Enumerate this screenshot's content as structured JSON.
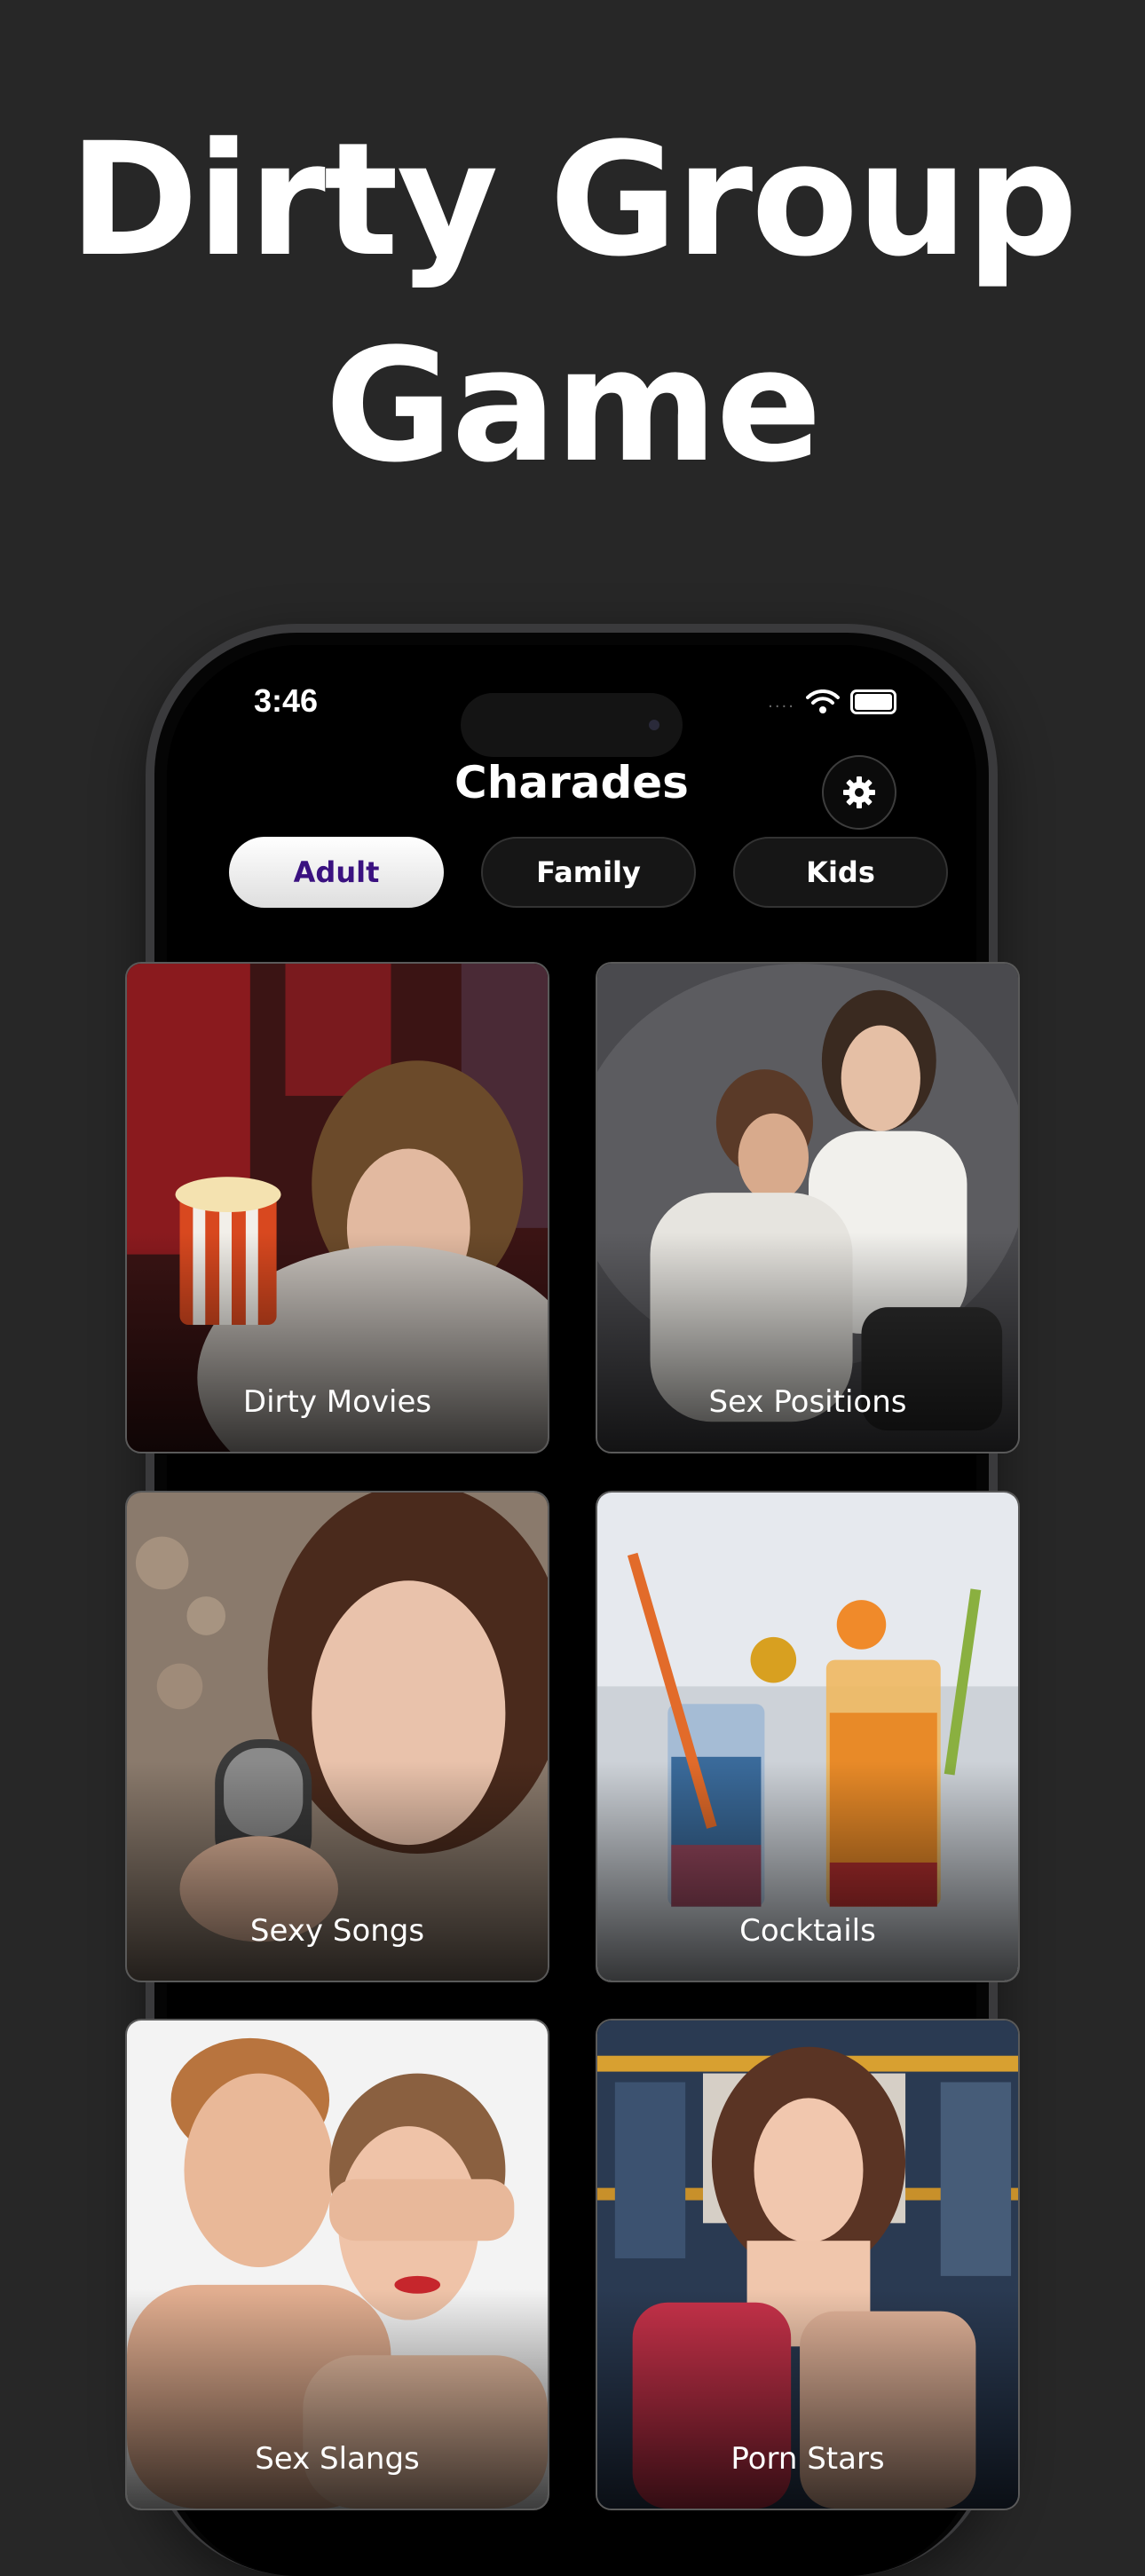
{
  "headline": {
    "line1": "Dirty Group",
    "line2": "Game"
  },
  "status_bar": {
    "time": "3:46",
    "signal": "....",
    "wifi_icon": "wifi-icon",
    "battery_icon": "battery-icon"
  },
  "app": {
    "title": "Charades",
    "settings_icon": "gear-icon"
  },
  "tabs": [
    {
      "label": "Adult",
      "active": true
    },
    {
      "label": "Family",
      "active": false
    },
    {
      "label": "Kids",
      "active": false
    }
  ],
  "categories": [
    {
      "label": "Dirty Movies"
    },
    {
      "label": "Sex Positions"
    },
    {
      "label": "Sexy Songs"
    },
    {
      "label": "Cocktails"
    },
    {
      "label": "Sex Slangs"
    },
    {
      "label": "Porn Stars"
    }
  ],
  "colors": {
    "background": "#272727",
    "active_tab_text": "#3a1180",
    "screen": "#000000"
  }
}
